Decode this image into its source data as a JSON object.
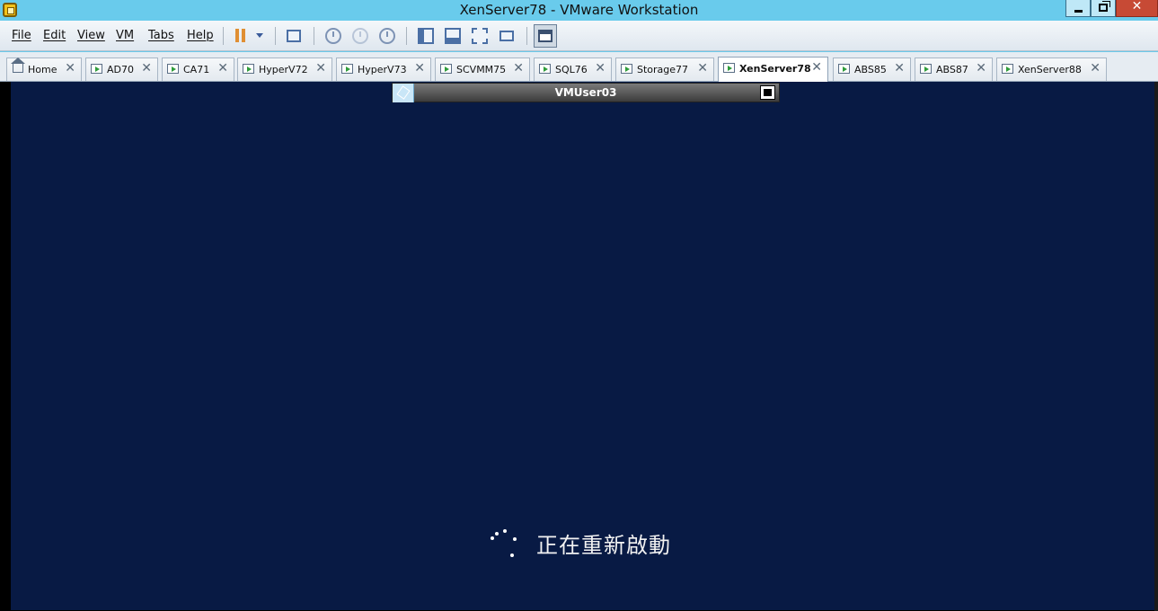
{
  "window": {
    "title": "XenServer78 - VMware Workstation",
    "close_glyph": "✕"
  },
  "menu": {
    "items": [
      "File",
      "Edit",
      "View",
      "VM",
      "Tabs",
      "Help"
    ]
  },
  "toolbar": {
    "icons": [
      "pause-icon",
      "dropdown-arrow-icon",
      "send-ctrl-alt-del-icon",
      "take-snapshot-icon",
      "revert-snapshot-icon",
      "snapshot-manager-icon",
      "show-library-icon",
      "show-thumbnail-bar-icon",
      "full-screen-icon",
      "unity-icon",
      "console-view-icon"
    ],
    "accent_color": "#e08f33"
  },
  "tabs": [
    {
      "label": "Home",
      "icon": "home-icon",
      "active": false
    },
    {
      "label": "AD70",
      "icon": "vm-icon",
      "active": false
    },
    {
      "label": "CA71",
      "icon": "vm-icon",
      "active": false
    },
    {
      "label": "HyperV72",
      "icon": "vm-icon",
      "active": false
    },
    {
      "label": "HyperV73",
      "icon": "vm-icon",
      "active": false
    },
    {
      "label": "SCVMM75",
      "icon": "vm-icon",
      "active": false
    },
    {
      "label": "SQL76",
      "icon": "vm-icon",
      "active": false
    },
    {
      "label": "Storage77",
      "icon": "vm-icon",
      "active": false
    },
    {
      "label": "XenServer78",
      "icon": "vm-icon",
      "active": true
    },
    {
      "label": "ABS85",
      "icon": "vm-icon",
      "active": false
    },
    {
      "label": "ABS87",
      "icon": "vm-icon",
      "active": false
    },
    {
      "label": "XenServer88",
      "icon": "vm-icon",
      "active": false
    }
  ],
  "tab_close_glyph": "✕",
  "vm": {
    "remote_session_title": "VMUser03",
    "status_text": "正在重新啟動",
    "background_color": "#081a44"
  }
}
